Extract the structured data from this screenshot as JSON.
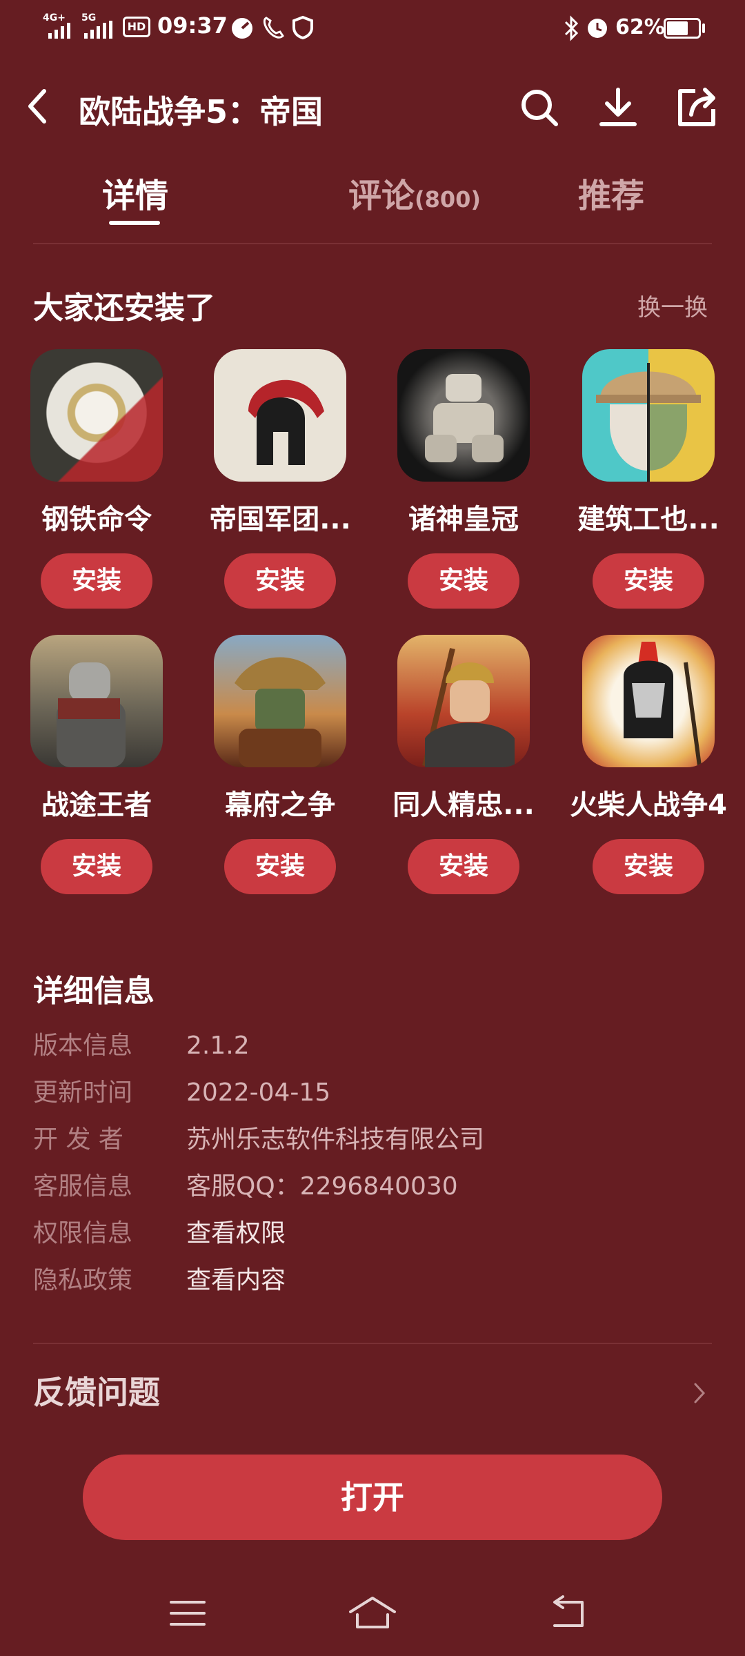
{
  "status_bar": {
    "network1": "4G+",
    "network2": "5G",
    "hd": "HD",
    "time": "09:37",
    "battery": "62%"
  },
  "header": {
    "title": "欧陆战争5：帝国",
    "icons": [
      "back-icon",
      "search-icon",
      "download-icon",
      "share-icon"
    ]
  },
  "tabs": [
    {
      "label": "详情",
      "count": ""
    },
    {
      "label": "评论",
      "count": "(800)"
    },
    {
      "label": "推荐",
      "count": ""
    }
  ],
  "also_installed": {
    "title": "大家还安装了",
    "refresh_label": "换一换",
    "apps": [
      {
        "name": "钢铁命令",
        "button": "安装"
      },
      {
        "name": "帝国军团...",
        "button": "安装"
      },
      {
        "name": "诸神皇冠",
        "button": "安装"
      },
      {
        "name": "建筑工也...",
        "button": "安装"
      },
      {
        "name": "战途王者",
        "button": "安装"
      },
      {
        "name": "幕府之争",
        "button": "安装"
      },
      {
        "name": "同人精忠...",
        "button": "安装"
      },
      {
        "name": "火柴人战争4",
        "button": "安装"
      }
    ]
  },
  "details": {
    "title": "详细信息",
    "rows": [
      {
        "label": "版本信息",
        "value": "2.1.2"
      },
      {
        "label": "更新时间",
        "value": "2022-04-15"
      },
      {
        "label": "开 发 者",
        "value": "苏州乐志软件科技有限公司"
      },
      {
        "label": "客服信息",
        "value": "客服QQ：2296840030"
      },
      {
        "label": "权限信息",
        "value": "查看权限"
      },
      {
        "label": "隐私政策",
        "value": "查看内容"
      }
    ]
  },
  "feedback": {
    "label": "反馈问题"
  },
  "open_button": {
    "label": "打开"
  },
  "colors": {
    "background": "#661d22",
    "accent": "#ca3a41"
  }
}
